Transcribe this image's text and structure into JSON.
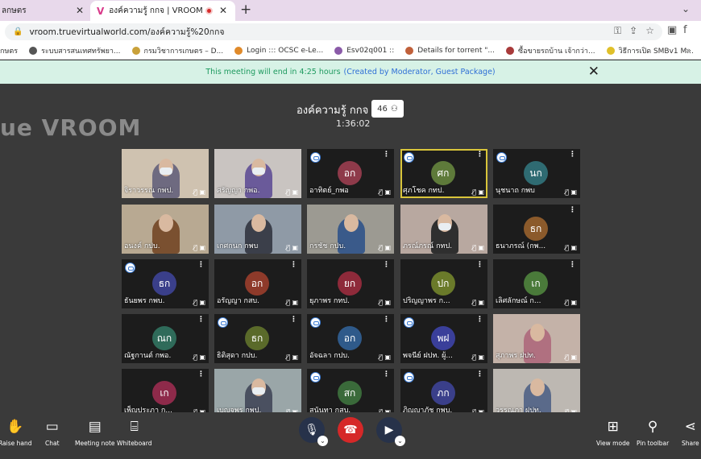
{
  "browser": {
    "tabs": [
      {
        "label": "ลกษตร",
        "active": false
      },
      {
        "label": "องค์ความรู้ กกจ | VROOM",
        "active": true
      }
    ],
    "url": "vroom.truevirtualworld.com/องค์ความรู้%20กกจ",
    "bookmarks": [
      "กษตร",
      "ระบบสารสนเทศทรัพยา...",
      "กรมวิชาการเกษตร – D...",
      "Login ::: OCSC e-Le...",
      "Esv02q001 ::",
      "Details for torrent \"...",
      "ซื้อขายรถบ้าน เจ้ากว่า...",
      "วิธีการเปิด SMBv1 M..."
    ]
  },
  "notice": {
    "text": "This meeting will end in 4:25 hours",
    "link": "(Created by Moderator, Guest Package)"
  },
  "meeting": {
    "brand": "ue VROOM",
    "title": "องค์ความรู้ กกจ",
    "participants": "46",
    "timer": "1:36:02"
  },
  "tiles": [
    {
      "name": "จิราวรรณ กพป.",
      "type": "video",
      "bg": "#cfc2b0",
      "shirt": "#6e6a80",
      "mask": true
    },
    {
      "name": "ศรัญญา กพอ.",
      "type": "video",
      "bg": "#c9c4c1",
      "shirt": "#6a5a9a",
      "mask": true
    },
    {
      "name": "อาทิตย์_กพอ",
      "type": "avatar",
      "initials": "อก",
      "color": "#8e3a4a",
      "mobile": true
    },
    {
      "name": "ศุภโชค กทป.",
      "type": "avatar",
      "initials": "ศก",
      "color": "#5e7a3a",
      "mobile": true,
      "highlight": true
    },
    {
      "name": "นุชนาถ กพบ",
      "type": "avatar",
      "initials": "นก",
      "color": "#2f6b72",
      "mobile": true
    },
    {
      "name": "อนงค์ กปบ.",
      "type": "video",
      "bg": "#b8a992",
      "shirt": "#7a5030",
      "mask": false
    },
    {
      "name": "เกศกนก กพบ",
      "type": "video",
      "bg": "#8f9aa6",
      "shirt": "#3b3f4a",
      "mask": false
    },
    {
      "name": "กรชัช กปบ.",
      "type": "video",
      "bg": "#9c9a92",
      "shirt": "#3a5a8a",
      "mask": false
    },
    {
      "name": "ภรณ์ภรณ์ กทป.",
      "type": "video",
      "bg": "#b8a8a0",
      "shirt": "#2f2f2f",
      "mask": true
    },
    {
      "name": "ธนาภรณ์ (กพ...",
      "type": "avatar",
      "initials": "ธก",
      "color": "#8b5a2b",
      "mobile": false
    },
    {
      "name": "ธันยพร กพบ.",
      "type": "avatar",
      "initials": "ธก",
      "color": "#3a3f8a",
      "mobile": true
    },
    {
      "name": "อรัญญา กสบ.",
      "type": "avatar",
      "initials": "อก",
      "color": "#8e3a2a",
      "mobile": false
    },
    {
      "name": "ยุภาพร กทป.",
      "type": "avatar",
      "initials": "ยก",
      "color": "#8e2a3a",
      "mobile": false
    },
    {
      "name": "ปริญญาพร ก...",
      "type": "avatar",
      "initials": "ปก",
      "color": "#6a7a2a",
      "mobile": false
    },
    {
      "name": "เลิศลักษณ์ ก...",
      "type": "avatar",
      "initials": "เก",
      "color": "#4a7a3a",
      "mobile": false
    },
    {
      "name": "ณัฐกานต์ กพอ.",
      "type": "avatar",
      "initials": "ณก",
      "color": "#2f6b5a",
      "mobile": false
    },
    {
      "name": "ธิติสุดา กปบ.",
      "type": "avatar",
      "initials": "ธก",
      "color": "#5a6a2a",
      "mobile": true
    },
    {
      "name": "อัจฉลา กปบ.",
      "type": "avatar",
      "initials": "อก",
      "color": "#2f5a8a",
      "mobile": true
    },
    {
      "name": "พจนีย์ ฝปท. ผู้...",
      "type": "avatar",
      "initials": "พฝ",
      "color": "#3a3f9a",
      "mobile": true
    },
    {
      "name": "สุภาพร ฝปท.",
      "type": "video",
      "bg": "#c4b2a8",
      "shirt": "#b07080",
      "mask": false
    },
    {
      "name": "เพ็ญประภา ก...",
      "type": "avatar",
      "initials": "เก",
      "color": "#8e2a4a",
      "mobile": false
    },
    {
      "name": "เบญจพร กพป.",
      "type": "video",
      "bg": "#9aa6a8",
      "shirt": "#4a5060",
      "mask": true
    },
    {
      "name": "สุนันทา กสบ.",
      "type": "avatar",
      "initials": "สก",
      "color": "#3a6a3a",
      "mobile": true
    },
    {
      "name": "ภิญญาภัช กพบ.",
      "type": "avatar",
      "initials": "ภก",
      "color": "#3a3f8a",
      "mobile": true
    },
    {
      "name": "วรรณภา ฝปท.",
      "type": "video",
      "bg": "#bdb8b2",
      "shirt": "#5a6a8a",
      "mask": false
    }
  ],
  "toolbar": {
    "raise_hand": "Raise hand",
    "chat": "Chat",
    "meeting_note": "Meeting note",
    "whiteboard": "Whiteboard",
    "view_mode": "View mode",
    "pin_toolbar": "Pin toolbar",
    "share": "Share"
  },
  "colors": {
    "notice_bg": "#d7f2e6",
    "notice_text": "#1e9a5f",
    "end_call": "#d62828",
    "highlight": "#d9c53a"
  }
}
